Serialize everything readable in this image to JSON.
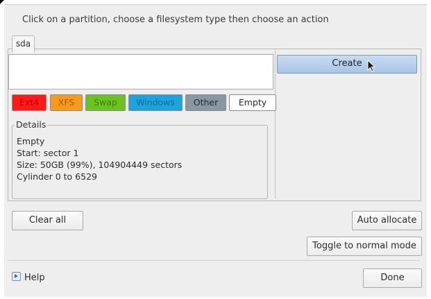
{
  "instruction": "Click on a partition, choose a filesystem type then choose an action",
  "disk_tab": "sda",
  "actions": {
    "create_label": "Create"
  },
  "filesystems": [
    {
      "label": "Ext4",
      "bg": "#ff1a1a",
      "fg": "#b30000"
    },
    {
      "label": "XFS",
      "bg": "#f59a1d",
      "fg": "#b35a00"
    },
    {
      "label": "Swap",
      "bg": "#6cc123",
      "fg": "#3d7f0a"
    },
    {
      "label": "Windows",
      "bg": "#20a3dc",
      "fg": "#0d6f9d"
    },
    {
      "label": "Other",
      "bg": "#8b96a3",
      "fg": "#1e2a36"
    },
    {
      "label": "Empty",
      "bg": "#ffffff",
      "fg": "#2b2b2b"
    }
  ],
  "details": {
    "legend": "Details",
    "lines": [
      "Empty",
      "Start: sector 1",
      "Size: 50GB (99%), 104904449 sectors",
      "Cylinder 0 to 6529"
    ]
  },
  "buttons": {
    "clear_all": "Clear all",
    "auto_allocate": "Auto allocate",
    "toggle_mode": "Toggle to normal mode",
    "done": "Done"
  },
  "help_label": "Help"
}
